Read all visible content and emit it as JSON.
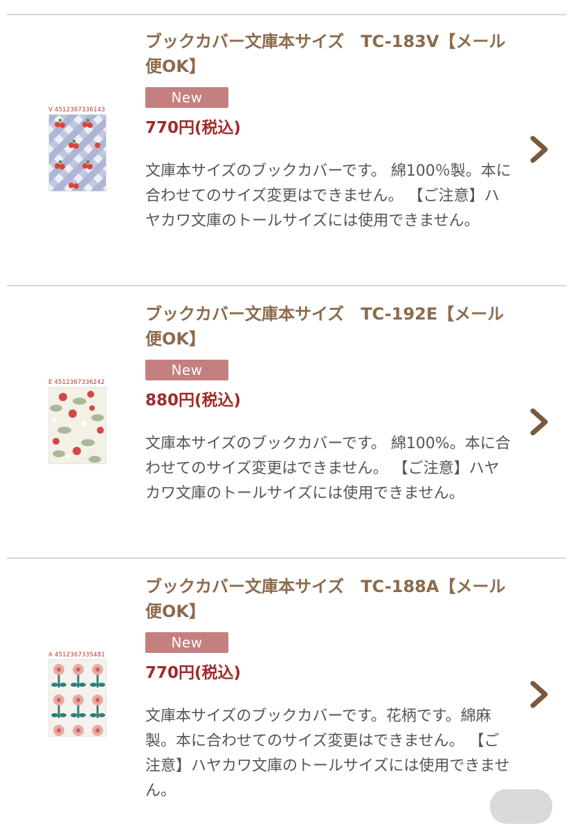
{
  "products": [
    {
      "title": "ブックカバー文庫本サイズ　TC-183V【メール便OK】",
      "badge": "New",
      "price": "770円(税込)",
      "description": "文庫本サイズのブックカバーです。 綿100％製。本に合わせてのサイズ変更はできません。 【ご注意】ハヤカワ文庫のトールサイズには使用できません。",
      "image_code": "V  4512367336143",
      "pattern": "cherry-gingham"
    },
    {
      "title": "ブックカバー文庫本サイズ　TC-192E【メール便OK】",
      "badge": "New",
      "price": "880円(税込)",
      "description": "文庫本サイズのブックカバーです。 綿100%。本に合わせてのサイズ変更はできません。 【ご注意】ハヤカワ文庫のトールサイズには使用できません。",
      "image_code": "E  4512367336242",
      "pattern": "strawberry-floral"
    },
    {
      "title": "ブックカバー文庫本サイズ　TC-188A【メール便OK】",
      "badge": "New",
      "price": "770円(税込)",
      "description": "文庫本サイズのブックカバーです。花柄です。綿麻製。本に合わせてのサイズ変更はできません。 【ご注意】ハヤカワ文庫のトールサイズには使用できません。",
      "image_code": "A  4512367335481",
      "pattern": "tulip-floral"
    }
  ],
  "icons": {
    "chevron": "chevron-right-icon"
  },
  "colors": {
    "title": "#8c6a4c",
    "price": "#a12a2a",
    "badge_bg": "#c47f7f",
    "description": "#555555",
    "divider": "#d6d6d6"
  }
}
